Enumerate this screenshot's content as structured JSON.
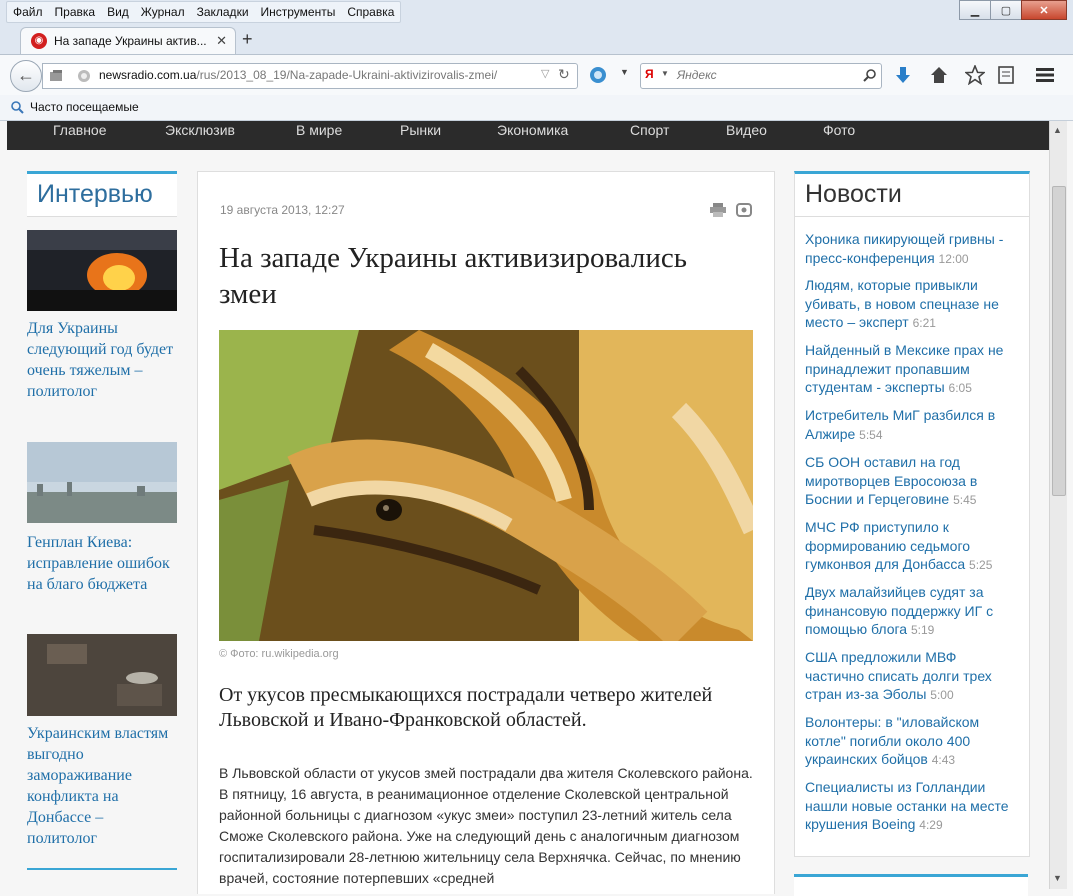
{
  "window": {
    "menu": [
      "Файл",
      "Правка",
      "Вид",
      "Журнал",
      "Закладки",
      "Инструменты",
      "Справка"
    ],
    "tab_title": "На западе Украины актив...",
    "url_host": "newsradio.com.ua",
    "url_path": "/rus/2013_08_19/Na-zapade-Ukraini-aktivizirovalis-zmei/",
    "search_placeholder": "Яндекс",
    "bookmarks_label": "Часто посещаемые"
  },
  "site_nav": [
    "Главное",
    "Эксклюзив",
    "В мире",
    "Рынки",
    "Экономика",
    "Спорт",
    "Видео",
    "Фото"
  ],
  "left": {
    "title": "Интервью",
    "items": [
      {
        "text": "Для Украины следующий год будет очень тяжелым – политолог"
      },
      {
        "text": "Генплан Киева: исправление ошибок на благо бюджета"
      },
      {
        "text": "Украинским властям выгодно замораживание конфликта на Донбассе – политолог"
      }
    ]
  },
  "article": {
    "date": "19 августа 2013, 12:27",
    "headline": "На западе Украины активизировались змеи",
    "caption": "© Фото: ru.wikipedia.org",
    "lead": "От укусов пресмыкающихся пострадали четверо жителей Львовской и Ивано-Франковской областей.",
    "body": "В Львовской области от укусов змей пострадали два жителя Сколевского района. В пятницу, 16 августа, в реанимационное отделение Сколевской центральной районной больницы с диагнозом «укус змеи» поступил 23-летний житель села Сможе Сколевского района. Уже на следующий день с аналогичным диагнозом госпитализировали 28-летнюю жительницу села Верхнячка. Сейчас, по мнению врачей, состояние потерпевших «средней"
  },
  "right": {
    "title": "Новости",
    "items": [
      {
        "text": "Хроника пикирующей гривны - пресс-конференция",
        "time": "12:00"
      },
      {
        "text": "Людям, которые привыкли убивать, в новом спецназе не место – эксперт",
        "time": "6:21"
      },
      {
        "text": "Найденный в Мексике прах не принадлежит пропавшим студентам - эксперты",
        "time": "6:05"
      },
      {
        "text": "Истребитель МиГ разбился в Алжире",
        "time": "5:54"
      },
      {
        "text": "СБ ООН оставил на год миротворцев Евросоюза в Боснии и Герцеговине",
        "time": "5:45"
      },
      {
        "text": "МЧС РФ приступило к формированию седьмого гумконвоя для Донбасса",
        "time": "5:25"
      },
      {
        "text": "Двух малайзийцев судят за финансовую поддержку ИГ с помощью блога",
        "time": "5:19"
      },
      {
        "text": "США предложили МВФ частично списать долги трех стран из-за Эболы",
        "time": "5:00"
      },
      {
        "text": "Волонтеры: в \"иловайском котле\" погибли около 400 украинских бойцов",
        "time": "4:43"
      },
      {
        "text": "Специалисты из Голландии нашли новые останки на месте крушения Boeing",
        "time": "4:29"
      }
    ]
  }
}
